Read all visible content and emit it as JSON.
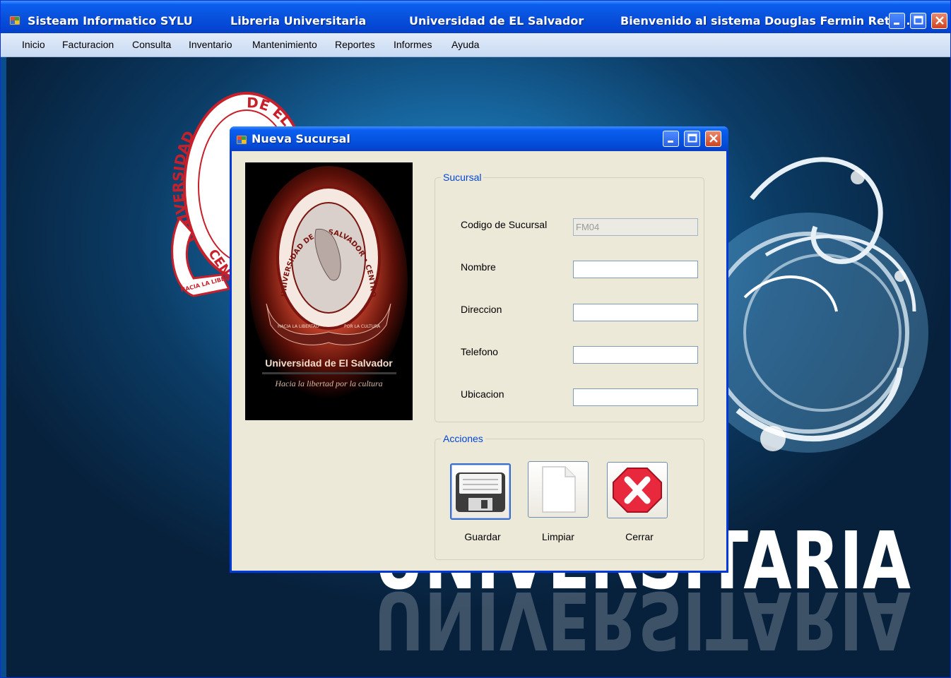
{
  "app": {
    "title_segments": [
      "Sisteam Informatico SYLU",
      "Libreria Universitaria",
      "Universidad de EL Salvador",
      "Bienvenido al sistema Douglas Fermin Reta..."
    ]
  },
  "menu": {
    "items": [
      "Inicio",
      "Facturacion",
      "Consulta",
      "Inventario",
      "Mantenimiento",
      "Reportes",
      "Informes",
      "Ayuda"
    ]
  },
  "background": {
    "seal_text_top": "DE EL S",
    "seal_text_left": "UNIVERSIDAD",
    "seal_text_bottom": "CENTR",
    "seal_ribbon": "HACIA LA LIBERTAD",
    "word": "UNIVERSITARIA"
  },
  "dialog": {
    "title": "Nueva Sucursal",
    "logo": {
      "name": "Universidad de El Salvador",
      "motto": "Hacia la libertad por la cultura",
      "seal_text": "UNIVERSIDAD DE EL SALVADOR • CENTRO AMERICA",
      "ribbon_left": "HACIA LA LIBERTAD",
      "ribbon_right": "POR LA CULTURA"
    },
    "group_sucursal": {
      "legend": "Sucursal",
      "fields": [
        {
          "label": "Codigo de Sucursal",
          "value": "FM04",
          "enabled": false
        },
        {
          "label": "Nombre",
          "value": "",
          "enabled": true
        },
        {
          "label": "Direccion",
          "value": "",
          "enabled": true
        },
        {
          "label": "Telefono",
          "value": "",
          "enabled": true
        },
        {
          "label": "Ubicacion",
          "value": "",
          "enabled": true
        }
      ]
    },
    "group_acciones": {
      "legend": "Acciones",
      "buttons": [
        {
          "label": "Guardar",
          "icon": "floppy-disk-icon"
        },
        {
          "label": "Limpiar",
          "icon": "blank-page-icon"
        },
        {
          "label": "Cerrar",
          "icon": "close-x-icon"
        }
      ]
    }
  },
  "colors": {
    "titlebar_blue": "#0a55e0",
    "legend_blue": "#0046d5",
    "dialog_bg": "#ece9d8",
    "close_red": "#e8283c"
  }
}
